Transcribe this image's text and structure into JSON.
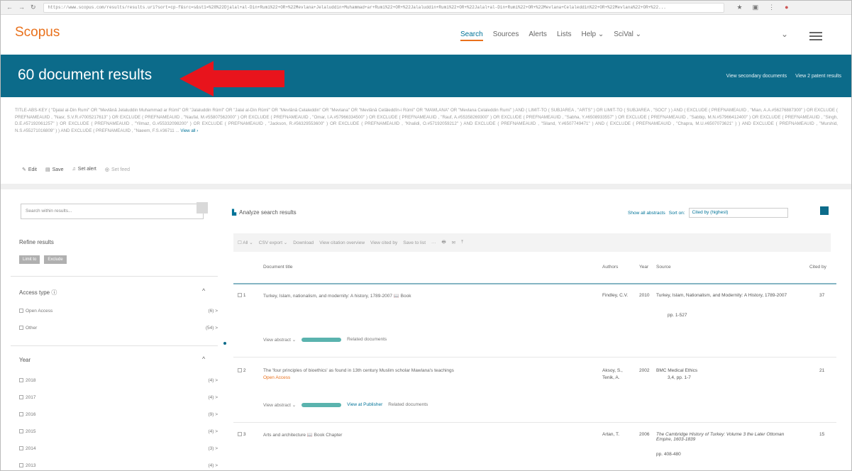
{
  "browser": {
    "url": "https://www.scopus.com/results/results.uri?sort=cp-f&src=s&st1=%28%22Djalal+al-Din+Rumi%22+OR+%22Mevlana+Jelaluddin+Muhammad+ar+Rumi%22+OR+%22Jalaluddin+Rumi%22+OR+%22Jalal+al-Din+Rumi%22+OR+%22Mevlana+Celaleddin%22+OR+%22Mevlana%22+OR+%22..."
  },
  "nav": {
    "logo": "Scopus",
    "items": [
      "Search",
      "Sources",
      "Alerts",
      "Lists",
      "Help ⌄",
      "SciVal ⌄"
    ],
    "active_index": 0,
    "more": "⌄"
  },
  "banner": {
    "title": "60 document results",
    "link_secondary": "View secondary documents",
    "link_patents": "View 2 patent results"
  },
  "query": {
    "text": "TITLE-ABS-KEY ( \"Djalal al-Din Rumi\" OR \"Mevlânâ Jelaluddin Muhammad ar Rûmî\" OR \"Jalaluddin Rûmî\" OR \"Jalal al-Din Rûmî\" OR \"Mevlânâ Celaleddin\" OR \"Mevlana\" OR \"Mevlânâ Celâleddîn-i Rûmî\" OR \"MAWLANA\" OR \"Mevlana Celaleddin Rumi\" ) AND ( LIMIT-TO ( SUBJAREA , \"ARTS\" ) OR LIMIT-TO ( SUBJAREA , \"SOCI\" ) ) AND ( EXCLUDE ( PREFNAMEAUID , \"Mian, A.A.#56276887300\" ) OR EXCLUDE ( PREFNAMEAUID , \"Nasr, S.V.R.#7005217613\" ) OR EXCLUDE ( PREFNAMEAUID , \"Naufal, M.#55807562000\" ) OR EXCLUDE ( PREFNAMEAUID , \"Omar, I.A.#57966334500\" ) OR EXCLUDE ( PREFNAMEAUID , \"Rauf, A.#55358269300\" ) OR EXCLUDE ( PREFNAMEAUID , \"Sabha, Y.#6508933557\" ) OR EXCLUDE ( PREFNAMEAUID , \"Sabbip, M.N.#57966412400\" ) OR EXCLUDE ( PREFNAMEAUID , \"Singh, D.E.#57192061257\" ) OR EXCLUDE ( PREFNAMEAUID , \"Yilmaz, G.#55332098200\" ) OR EXCLUDE ( PREFNAMEAUID , \"Jackson, R.#56329553600\" ) OR EXCLUDE ( PREFNAMEAUID , \"Khalidi, O.#57192059212\" ) AND EXCLUDE ( PREFNAMEAUID , \"Siland, Y.#6507749471\" ) AND ( EXCLUDE ( PREFNAMEAUID , \"Chapra, M.U.#6507073621\" ) ) AND EXCLUDE ( PREFNAMEAUID , \"Murshid, N.S.#55271016809\" ) ) AND EXCLUDE ( PREFNAMEAUID , \"Naeem, F.S.#36711 ...",
    "view_all": "View all ›",
    "tools": [
      "Edit",
      "Save",
      "Set alert",
      "Set feed"
    ]
  },
  "sidebar": {
    "search_placeholder": "Search within results...",
    "refine_title": "Refine results",
    "limit_to": "Limit to",
    "exclude": "Exclude",
    "access_type": {
      "title": "Access type ⓘ",
      "items": [
        {
          "label": "Open Access",
          "count": "(6) >"
        },
        {
          "label": "Other",
          "count": "(54) >"
        }
      ]
    },
    "year": {
      "title": "Year",
      "items": [
        {
          "label": "2018",
          "count": "(4) >"
        },
        {
          "label": "2017",
          "count": "(4) >"
        },
        {
          "label": "2016",
          "count": "(9) >"
        },
        {
          "label": "2015",
          "count": "(4) >"
        },
        {
          "label": "2014",
          "count": "(3) >"
        },
        {
          "label": "2013",
          "count": "(4) >"
        }
      ]
    }
  },
  "main": {
    "analyze": "Analyze search results",
    "show_abstracts": "Show all abstracts",
    "sort_on": "Sort on:",
    "sort_value": "Cited by (highest)",
    "toolbar": [
      "☐ All ⌄",
      "CSV export ⌄",
      "Download",
      "View citation overview",
      "View cited by",
      "Save to list",
      "···",
      "🖶",
      "✉",
      "⤒"
    ],
    "headers": {
      "title": "Document title",
      "authors": "Authors",
      "year": "Year",
      "source": "Source",
      "cited": "Cited by"
    },
    "rows": [
      {
        "num": "1",
        "title": "Turkey, Islam, nationalism, and modernity: A history, 1789-2007 📖 Book",
        "access": "",
        "authors": "Findley, C.V.",
        "year": "2010",
        "source": "Turkey, Islam, Nationalism, and Modernity: A History, 1789-2007",
        "pages": "pp. 1-527",
        "cited": "37",
        "view_abstract": "View abstract ⌄",
        "publisher": "",
        "related": "Related documents"
      },
      {
        "num": "2",
        "title": "The 'four principles of bioethics' as found in 13th century Muslim scholar Mawlana's teachings",
        "access": "Open Access",
        "authors": "Aksoy, S.,",
        "authors2": "Tenik, A.",
        "year": "2002",
        "source": "BMC Medical Ethics",
        "pages": "3,4, pp. 1-7",
        "cited": "21",
        "view_abstract": "View abstract ⌄",
        "publisher": "View at Publisher",
        "related": "Related documents"
      },
      {
        "num": "3",
        "title": "Arts and architecture 📖 Book Chapter",
        "access": "",
        "authors": "Artan, T.",
        "year": "2006",
        "source": "The Cambridge History of Turkey: Volume 3 the Later Ottoman Empire, 1603-1839",
        "pages": "pp. 408-480",
        "cited": "15",
        "view_abstract": "",
        "publisher": "",
        "related": ""
      }
    ]
  },
  "colors": {
    "brand": "#e9711c",
    "banner": "#0c6b8a",
    "arrow": "#e8141c"
  }
}
